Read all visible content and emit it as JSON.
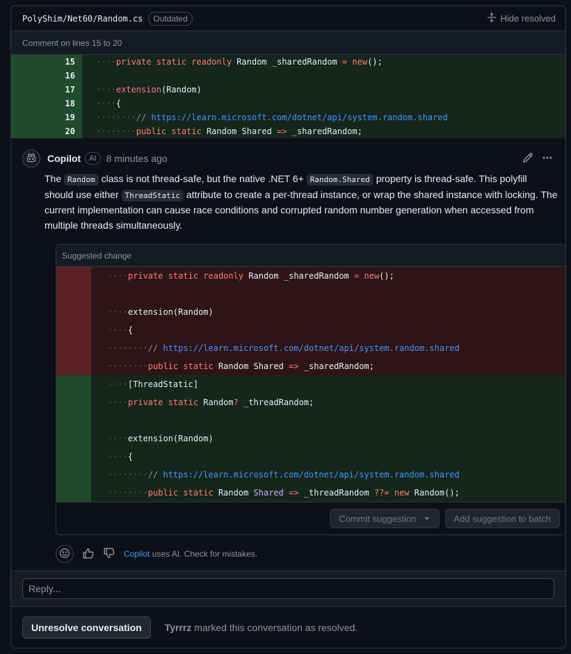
{
  "header": {
    "file_path": "PolyShim/Net60/Random.cs",
    "badge": "Outdated",
    "hide_resolved": "Hide resolved"
  },
  "comment_on_lines": "Comment on lines 15 to 20",
  "diff": {
    "line_numbers": [
      "15",
      "16",
      "17",
      "18",
      "19",
      "20"
    ]
  },
  "comment": {
    "author": "Copilot",
    "ai_badge": "AI",
    "time": "8 minutes ago",
    "body": {
      "p1": "The ",
      "code1": "Random",
      "p2": " class is not thread-safe, but the native .NET 6+ ",
      "code2": "Random.Shared",
      "p3": " property is thread-safe. This polyfill should use either ",
      "code3": "ThreadStatic",
      "p4": " attribute to create a per-thread instance, or wrap the shared instance with locking. The current implementation can cause race conditions and corrupted random number generation when accessed from multiple threads simultaneously."
    }
  },
  "suggested_change": {
    "title": "Suggested change",
    "commit_label": "Commit suggestion",
    "batch_label": "Add suggestion to batch"
  },
  "reactions": {
    "copilot_link": "Copilot",
    "note": " uses AI. Check for mistakes."
  },
  "reply": {
    "placeholder": "Reply..."
  },
  "resolve": {
    "button": "Unresolve conversation",
    "user": "Tyrrrz",
    "message": " marked this conversation as resolved."
  },
  "colors": {
    "accent_link": "#4493f8",
    "addition_gutter": "#1f4a2c",
    "deletion_gutter": "#5b2226"
  }
}
